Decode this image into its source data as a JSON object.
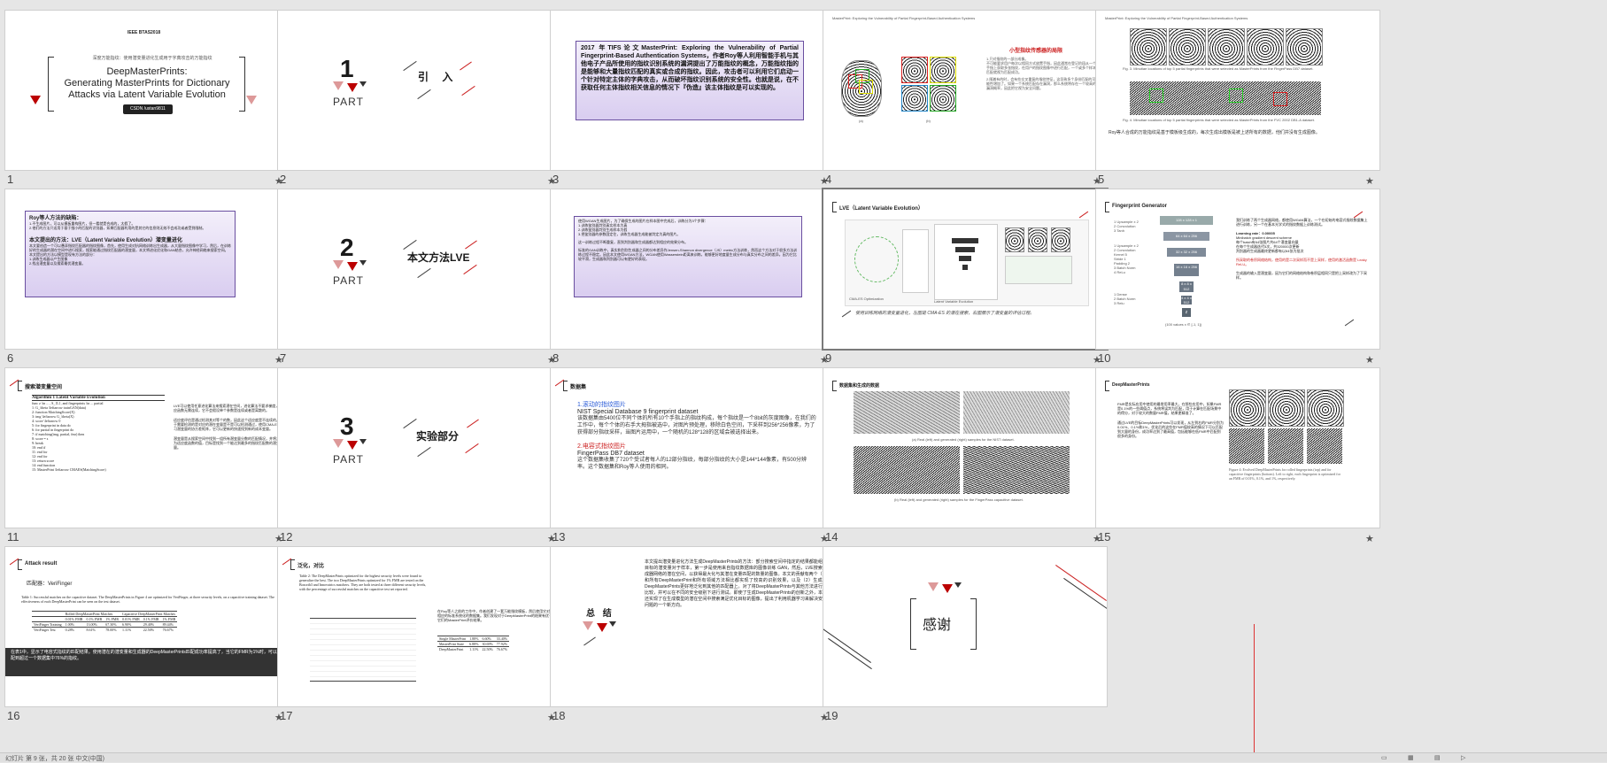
{
  "status_bar": {
    "left_text": "幻灯片 第 9 张，共 20 张   中文(中国)"
  },
  "slides": [
    {
      "number": "1",
      "tag": "IEEE BTAS2018",
      "subtitle": "深度万能指纹：使用潜变量进化生成用于字典攻击的万能指纹",
      "title_lines": [
        "DeepMasterPrints:",
        "Generating MasterPrints for Dictionary",
        "Attacks via Latent Variable Evolution"
      ],
      "author": "CSDN /ustan9811"
    },
    {
      "number": "2",
      "part_num": "1",
      "part_lbl": "PART",
      "section": "引  入"
    },
    {
      "number": "3",
      "text": "2017 年TIFS论文MasterPrint: Exploring the Vulnerability of Partial Fingerprint-Based Authentication Systems，作者Roy等人利用智能手机与其他电子产品所使用的指纹识别系统的漏洞提出了万能指纹的概念，万能指纹指的是能够和大量指纹匹配的真实或合成的指纹。因此，攻击者可以利用它们启动一个针对特定主体的字典攻击，从而破坏指纹识别系统的安全性。也就是说，在不获取任何主体指纹相关信息的情况下『伪造』该主体指纹是可以实现的。"
    },
    {
      "number": "4",
      "header": "MasterPrint: Exploring the Vulnerability of Partial Fingerprint-Based Authentication Systems",
      "heading": "小型指纹传感器的局限",
      "points": [
        "1.只对指纹的一部分成像。",
        "不可能要求用户每次以相同方式放置手指，因此通常在登记阶段从一个手指上获取多张指纹，在用户的指纹图像中进行匹配，一个或多个样本匹配就视为匹配成功。",
        "2.随着有的时，会有些交叉重复的指纹特征，这导致多个身份匹配的可能性增加了。如果一个系统匹配存在漏洞，那么系统将存在一个较高的漏洞概率，因此把它视为安全问题。"
      ],
      "captions": [
        "(a)",
        "(b)"
      ]
    },
    {
      "number": "5",
      "header": "MasterPrint: Exploring the Vulnerability of Partial Fingerprint-Based Authentication Systems",
      "fig3": "Fig. 3.   Minutiae locations of top 5 partial fingerprints that were selected as MasterPrints from the FingerPass DB7 dataset.",
      "fig4": "Fig. 4.   Minutiae locations of top 5 partial fingerprints that were selected as MasterPrints from the FVC 2002 DB1-A dataset.",
      "caption": "Roy等人合成的万能指纹是基于模板级生成的，每次生成出模板是被上述所有的数据，他们并没有生成图像。"
    },
    {
      "number": "6",
      "heading1": "Roy等人方法的缺陷：",
      "points1": [
        "1.不生成图片，可以从模板重构图片，但一看就是合成的，太假了。",
        "2.他们的方法只适用于基于细小的匹配的识别器，如果匹配器利用的是其它的信息则无效不会成功或者受到限制。"
      ],
      "heading2": "本文提出的方法：LVE（Latent Variable Evolution）潜变量进化",
      "points2": [
        "本文要创造一个可以愚弄指纹匹配器的指纹图像，首先，使用生成对抗网络训练出生成器，从大量指纹图像中学习，然后，在训练好的生成器的潜在空间中进行搜索，搜索能通过指纹匹配器的潜变量，本文将进化优化和GAN结合，允许神经网络来搜索空间。",
        "本文提出的方法以模型是现有方法的部分：",
        "1.训练生成器以产生图像",
        "2.找出潜变量以及搜索最优潜变量。"
      ]
    },
    {
      "number": "7",
      "part_num": "2",
      "part_lbl": "PART",
      "section": "本文方法LVE"
    },
    {
      "number": "8",
      "lines": [
        "使用WGAN生成图片，为了确保生成的图片在样本图中完成后，训练分为3个步骤：",
        "1.训练鉴别器判别真实样本为真",
        "2.训练鉴别器判别生成样本为假",
        "3.把鉴别器的参数固定住，训练生成器生成能被判定为真的图片。",
        "这一训练过程不断重复，直到判别器和生成器都达到相应的效果分布。",
        "标准的GAN训练中，真实和判别生成器之间的分布差异作Jensen-Shannon divergence（JS）metric方法训练，然而这个方法对于很多方法训练过程不稳定。因此本文使用WGAN方法，WGAN使用Wasserstein距离来训练，能够更好地度量生成分布与真实分布之间的差异。因为它比较平滑，生成器和判别器可以有更好的表现。"
      ]
    },
    {
      "number": "9",
      "heading": "LVE（Latent Variable Evolution）",
      "labels": [
        "CMA-ES Optimization",
        "Latent Variable Evolution"
      ],
      "caption": "使用训练网络的潜变量进化，左图是 CMA-ES 的潜在搜索，右图展示了潜变量的评估过程。"
    },
    {
      "number": "10",
      "heading": "Fingerprint Generator",
      "arch_left": [
        "1 Upsample x 2",
        "2 Convolution",
        "3 Tanh",
        "1 Upsample x 2",
        "2 Convolution",
        "Kernel 5",
        "Stride 1",
        "Padding 2",
        "3 Batch Norm",
        "4 ReLu",
        "1 Dense",
        "2 Batch Norm",
        "3 Relu"
      ],
      "arch_blocks": [
        "128 x 128 x 1",
        "64 x 64 x 256",
        "32 x 32 x 256",
        "16 x 16 x 256",
        "8 x 8 x 512",
        "4 x 4 x 512",
        "z"
      ],
      "caption_bottom": "(100 values x ∈ [-1, 1])",
      "right_text": [
        "我们训练了两个生成器网络，都使用WGAN算法，一个在初始的电容式指纹数据集上进行训练，另一个在基本光学式的指纹数据上训练测试。",
        "Learning rate：0.00005",
        "Minibatch gradient descent scheme",
        "每个batch有64张图片共64个潜变量向量",
        "在每个生成器迭代5次，共320000次更新",
        "判别器的生成器最终更新都有以64张为批次",
        "所采取的卷积网络结构，使用的是二次采样而不是上采样，使用的激活函数是 Leaky ReLU。",
        "生成器的输入是潜变量，因为它们的网络结构和卷积层相同只是把上采样改为了下采样。"
      ]
    },
    {
      "number": "11",
      "heading": "搜索潜变量空间",
      "algo_title": "Algorithm 1 Latent Variable Evolution",
      "algo_lines": [
        "func z \\in ... , S_{L}, and fingerprints \\in ... partial",
        "1: G_\\theta \\leftarrow trainGAN(data)",
        "2: function MatchingScore(X)",
        "3:   img \\leftarrow G_\\theta(X)",
        "4:   score \\leftarrow 0",
        "5:   for fingerprint in data do",
        "6:     for partial in fingerprint do",
        "7:       if matching(img, partial, fmr) then",
        "8:         score = s",
        "9:         break",
        "10:      end if",
        "11:    end for",
        "12:  end for",
        "13:  return score",
        "14: end function",
        "15: MasterPrint \\leftarrow CMAES(MatchingScore)"
      ],
      "right_text": [
        "LVE可以使用任意进化算法来搜索潜在空间，进化算法不要求梯度，适应函数无需连续，它不会假设单个参数是连续或者是离散的。",
        "适应度评估是通过检测其对等个的数，因此这个适应度是不连续的。由于需要检测的是对应的潜在变量是不是可以检测通过，使用CMA-ES学习潜变量的协方差矩阵，它可以更新的快速找到新的成本变量。",
        "潜变量是从搜索空间中找到一组所有潜变量分数的匹配情况，并将其作为适应度函数的值，目标是找到一个能达到最多的指纹匹配数的潜变量。"
      ]
    },
    {
      "number": "12",
      "part_num": "3",
      "part_lbl": "PART",
      "section": "实验部分"
    },
    {
      "number": "13",
      "heading": "数据集",
      "sub1": "1.滚动的指纹图片",
      "title1": "NIST Special Database 9 fingerprint dataset",
      "body1": "该数据集由5400位不同个体的所有10个手指上的指纹构成，每个指纹是一个8bit的灰度图像，在我们的工作中，每个个体的右手大拇指被选中，对图片预处理，移除白色空间，下采样到256*256像素，为了获得部分指纹采样，当图片运用中，一个随机的128*128的区域会被选择出来。",
      "sub2": "2.电容式指纹图片",
      "title2": "FingerPass DB7 dataset",
      "body2": "这个数据集收集了720个受试者每人的12部分指纹，每部分指纹的大小是144*144像素，有500分辨率。这个数据集和Roy等人使用的相同。"
    },
    {
      "number": "14",
      "heading": "数据集和生成的数据",
      "cap_a": "(a) Real (left) and generated (right) samples for the NIST dataset.",
      "cap_b": "(b) Real (left) and generated (right) samples for the FingerPass capacitive dataset."
    },
    {
      "number": "15",
      "heading": "DeepMasterPrints",
      "text1": "FMR是实际应用中使用的最常用率最大，在那些应用中，如果FMR是0.1%的一些阈值点，系统将误判为匹配，用于计算在匹配场景中的得分，对于较大的数量FMR值，结果更精准了。",
      "text2": "通过LVE的目标DeepMasterPrints可以发现，从左到右的FMR分别为0.01%、0.1%和1%，优化后的这些在FMR值较高的情况下可以匹配到大量的身份，成功率达到了最高值，包括能够在低FMR中匹配到很多的身份。",
      "fig_caption": "Figure 4: Evolved DeepMasterPrints for rolled fingerprints (top) and for capacitive fingerprints (bottom). Left to right, each fingerprint is optimized for an FMR of 0.01%, 0.1%, and 1%, respectively."
    },
    {
      "number": "16",
      "heading": "Attack result",
      "sub": "匹配器：VeriFinger",
      "table_caption": "Table 1: Successful matches on the capacitive dataset. The DeepMasterPrints in Figure 4 are optimized for VeriFinger, at three security levels, on a capacitive training dataset. The effectiveness of each DeepMasterPrint can be seen on the test dataset.",
      "table_cols": [
        "",
        "Rolled DeepMasterPrint Matches",
        "",
        "",
        "Capacitive DeepMasterPrint Matches",
        "",
        ""
      ],
      "table_sub": [
        "",
        "0.01% FMR",
        "0.1% FMR",
        "1% FMR",
        "0.01% FMR",
        "0.1% FMR",
        "1% FMR"
      ],
      "table_rows": [
        [
          "VeriFinger Training",
          "1.00%",
          "13.00%",
          "67.30%",
          "6.90%",
          "29.40%",
          "89.44%"
        ],
        [
          "VeriFinger Test",
          "0.28%",
          "8.61%",
          "78.00%",
          "1.11%",
          "22.50%",
          "76.67%"
        ]
      ],
      "footer": "在表1中，显示了电容式指纹的匹配结果。使用潜在的潜变量和生成器的DeepMasterPrints匹配成功率提高了，当它的FMR为1%时，可以匹配到超过一个数据集中76%的指纹。"
    },
    {
      "number": "17",
      "heading": "泛化，对比",
      "table_caption": "Table 2: The DeepMasterPrints optimized for the highest security levels were found to generalize the best. The two DeepMasterPrints optimized for 1% FMR are tested on the Bozorth3 and Innovatrics matchers. They are both tested at three different security levels, with the percentage of successful matches on the capacitive test set reported.",
      "right_text": "在Roy等人之前的工作中，作者创建了一套万能指纹模板，然后使用它对相应的标准系统化的数据集。我们发现对于DeepMasterPrint的结果有优于它们的MasterPrint评价结果。",
      "rows": [
        [
          "Single MasterPrint",
          "1.88%",
          "6.60%",
          "33.40%"
        ],
        [
          "MasterPrint State",
          "6.88%",
          "30.69%",
          "77.92%"
        ],
        [
          "DeepMasterPrint",
          "1.11%",
          "22.50%",
          "76.67%"
        ]
      ]
    },
    {
      "number": "18",
      "heading": "总 结",
      "text": "本文提出潜变量进化方法生成DeepMasterPrints的方法：部分搜索空间中指定的结果都能组织目标的潜变量对于样本，第一步是使用来自指纹数据库的图像训练 GAN，然后，LVE搜索生成器网络的潜在空间，以获得最大化与其潜在变量匹配的数量的图像。本文的贡献有两个（1）和所有DeepMasterPrint和所有领域方法相比都实现了较高的识别效果，以及（2）生成的DeepMasterPrints更好地泛化到其他的匹配器上。对了将DeepMasterPrints与其他方法进行了比较，并可以在不同的安全级别下进行测试。即使了生成DeepMasterPrints的创新之外，本文还实现了在生成模型的潜在空间中搜索满足优化目标的图像，提出了利用机器学习来解决安全问题的一个新方向。"
    },
    {
      "number": "19",
      "text": "感谢"
    }
  ]
}
